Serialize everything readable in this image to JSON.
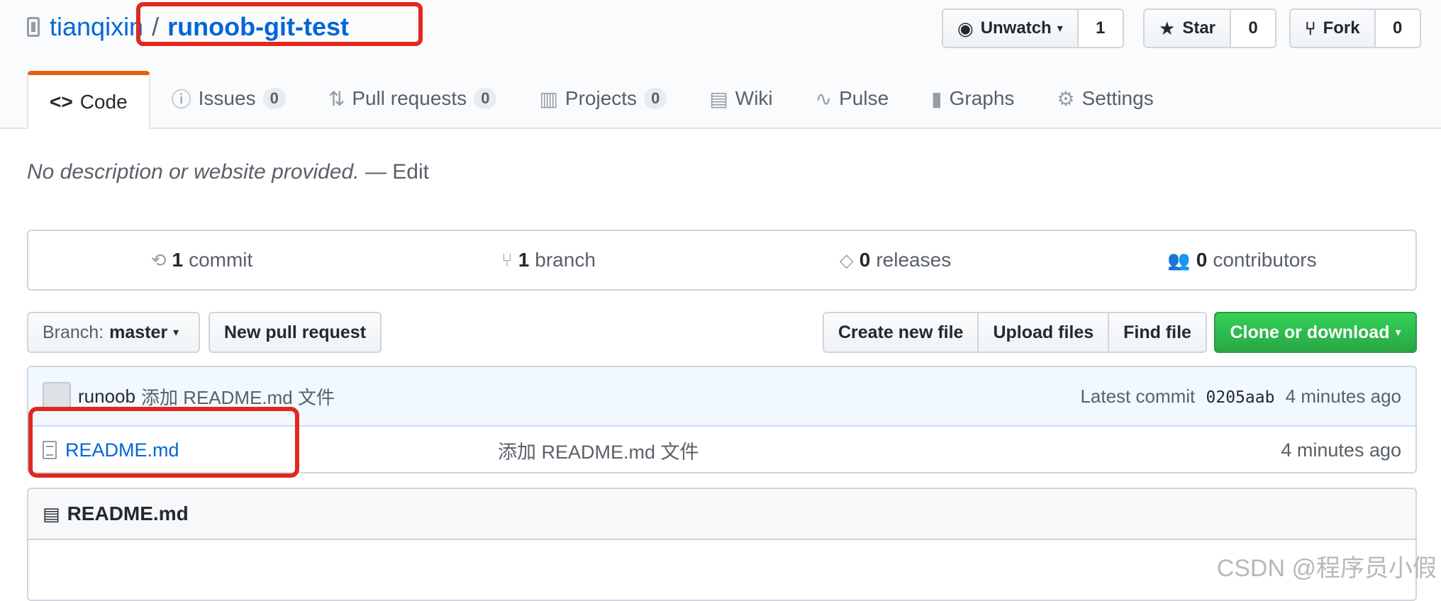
{
  "repo": {
    "owner": "tianqixin",
    "separator": "/",
    "name": "runoob-git-test"
  },
  "actions": {
    "watch_label": "Unwatch",
    "watch_count": "1",
    "star_label": "Star",
    "star_count": "0",
    "fork_label": "Fork",
    "fork_count": "0"
  },
  "tabs": [
    {
      "icon": "code-icon",
      "glyph": "<>",
      "label": "Code",
      "count": ""
    },
    {
      "icon": "issue-icon",
      "glyph": "ⓘ",
      "label": "Issues",
      "count": "0"
    },
    {
      "icon": "pull-request-icon",
      "glyph": "⇅",
      "label": "Pull requests",
      "count": "0"
    },
    {
      "icon": "project-icon",
      "glyph": "▥",
      "label": "Projects",
      "count": "0"
    },
    {
      "icon": "book-icon",
      "glyph": "▤",
      "label": "Wiki",
      "count": ""
    },
    {
      "icon": "pulse-icon",
      "glyph": "∿",
      "label": "Pulse",
      "count": ""
    },
    {
      "icon": "graph-icon",
      "glyph": "▮",
      "label": "Graphs",
      "count": ""
    },
    {
      "icon": "gear-icon",
      "glyph": "⚙",
      "label": "Settings",
      "count": ""
    }
  ],
  "description": {
    "text": "No description or website provided.",
    "edit": "— Edit"
  },
  "summary": {
    "commits_count": "1",
    "commits_label": "commit",
    "branches_count": "1",
    "branches_label": "branch",
    "releases_count": "0",
    "releases_label": "releases",
    "contributors_count": "0",
    "contributors_label": "contributors"
  },
  "toolbar": {
    "branch_label": "Branch:",
    "branch_value": "master",
    "new_pull_request": "New pull request",
    "create_new_file": "Create new file",
    "upload_files": "Upload files",
    "find_file": "Find file",
    "clone_or_download": "Clone or download"
  },
  "latest_commit": {
    "author": "runoob",
    "message": "添加 README.md 文件",
    "prefix": "Latest commit",
    "sha": "0205aab",
    "age": "4 minutes ago"
  },
  "files": [
    {
      "name": "README.md",
      "message": "添加 README.md 文件",
      "age": "4 minutes ago"
    }
  ],
  "readme": {
    "title": "README.md"
  },
  "watermark": "CSDN @程序员小假",
  "colors": {
    "link": "#0366d6",
    "highlight_box": "#e0281f",
    "clone_button": "#28a745",
    "active_tab_accent": "#e36209"
  }
}
